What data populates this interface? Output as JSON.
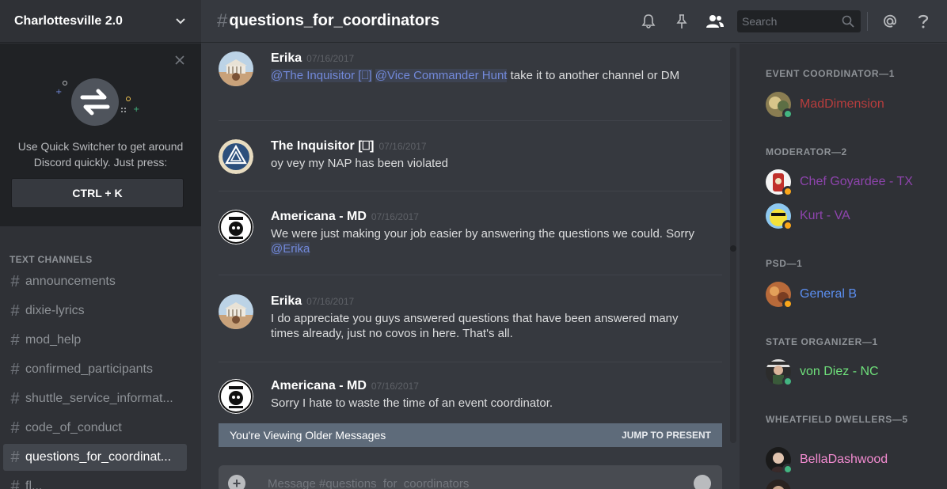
{
  "guild": {
    "name": "Charlottesville 2.0"
  },
  "quick_switcher": {
    "text": "Use Quick Switcher to get around Discord quickly. Just press:",
    "shortcut": "CTRL + K"
  },
  "channels": {
    "header": "TEXT CHANNELS",
    "items": [
      {
        "label": "announcements"
      },
      {
        "label": "dixie-lyrics"
      },
      {
        "label": "mod_help"
      },
      {
        "label": "confirmed_participants"
      },
      {
        "label": "shuttle_service_informat..."
      },
      {
        "label": "code_of_conduct"
      },
      {
        "label": "questions_for_coordinat..."
      },
      {
        "label": "fl..."
      }
    ],
    "active_index": 6
  },
  "topbar": {
    "hash": "#",
    "channel_name": "questions_for_coordinators",
    "search_placeholder": "Search",
    "icons": [
      "bell-icon",
      "pin-icon",
      "members-icon",
      "search-icon",
      "at-icon",
      "help-icon"
    ]
  },
  "messages": [
    {
      "author": "Erika",
      "timestamp": "07/16/2017",
      "mention1": "@The Inquisitor [⎕]",
      "mention2": "@Vice Commander Hunt",
      "text": " take it to another channel or DM"
    },
    {
      "author": "The Inquisitor [⎕]",
      "timestamp": "07/16/2017",
      "text": "oy vey my NAP has been violated"
    },
    {
      "author": "Americana - MD",
      "timestamp": "07/16/2017",
      "text": "We were just making your job easier by answering the questions we could. Sorry ",
      "mention": "@Erika"
    },
    {
      "author": "Erika",
      "timestamp": "07/16/2017",
      "text": "I do appreciate you guys answered questions that have been answered many times already, just no covos in here. That's all."
    },
    {
      "author": "Americana - MD",
      "timestamp": "07/16/2017",
      "text": "Sorry I hate to waste the time of an event coordinator."
    }
  ],
  "older_bar": {
    "label": "You're Viewing Older Messages",
    "jump": "JUMP TO PRESENT"
  },
  "composer": {
    "placeholder": "Message #questions_for_coordinators"
  },
  "members": {
    "roles": [
      {
        "title": "EVENT COORDINATOR—1",
        "members": [
          {
            "name": "MadDimension",
            "color": "#b73d3d",
            "status": "#43b581"
          }
        ]
      },
      {
        "title": "MODERATOR—2",
        "members": [
          {
            "name": "Chef Goyardee - TX",
            "color": "#8e44ad",
            "status": "#faa61a"
          },
          {
            "name": "Kurt - VA",
            "color": "#8e44ad",
            "status": "#faa61a"
          }
        ]
      },
      {
        "title": "PSD—1",
        "members": [
          {
            "name": "General B",
            "color": "#5b8ef0",
            "status": "#faa61a"
          }
        ]
      },
      {
        "title": "STATE ORGANIZER—1",
        "members": [
          {
            "name": "von Diez - NC",
            "color": "#6fe07b",
            "status": "#43b581"
          }
        ]
      },
      {
        "title": "WHEATFIELD DWELLERS—5",
        "members": [
          {
            "name": "BellaDashwood",
            "color": "#f28bd0",
            "status": "#43b581"
          }
        ]
      }
    ]
  },
  "colors": {
    "accent": "#7289da",
    "online": "#43b581",
    "idle": "#faa61a"
  }
}
